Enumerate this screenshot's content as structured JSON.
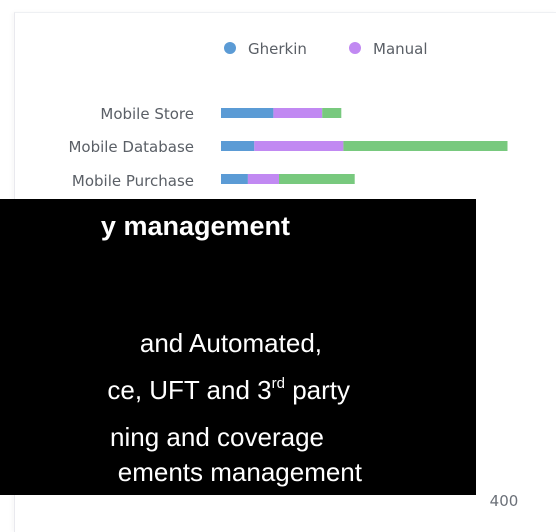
{
  "colors": {
    "background": "#ffffff",
    "gherkin": "#5b9bd5",
    "manual": "#c189f2",
    "automated": "#78c97e",
    "overlay_bg": "#000000",
    "overlay_text": "#ffffff"
  },
  "chart_data": {
    "type": "bar",
    "orientation": "horizontal",
    "stacked": true,
    "legend_position": "top",
    "categories": [
      "Mobile Store",
      "Mobile Database",
      "Mobile Purchase"
    ],
    "series": [
      {
        "name": "Gherkin",
        "color": "#5b9bd5",
        "values": [
          74,
          47,
          38
        ]
      },
      {
        "name": "Manual",
        "color": "#c189f2",
        "values": [
          69,
          126,
          44
        ]
      },
      {
        "name": "",
        "color": "#78c97e",
        "values": [
          27,
          232,
          107
        ]
      }
    ],
    "x_tick_labels_visible": [
      "400"
    ],
    "xlim": [
      0,
      400
    ]
  },
  "overlay": {
    "title": "y management",
    "line1": " and Automated,",
    "line2_before_sup": "ce, UFT and 3",
    "line2_sup": "rd",
    "line2_after_sup": " party",
    "line3": "ning and coverage",
    "line4": "ements management"
  }
}
